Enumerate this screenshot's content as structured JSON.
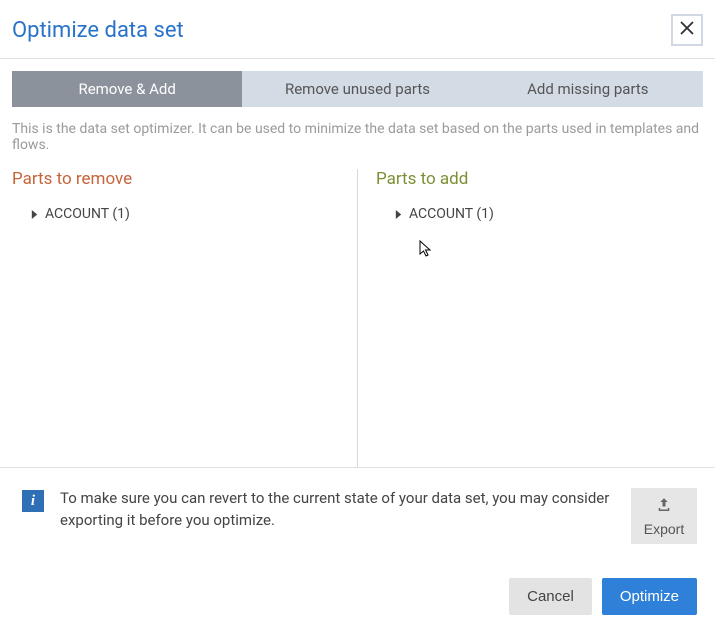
{
  "header": {
    "title": "Optimize data set"
  },
  "tabs": {
    "combined": "Remove & Add",
    "remove": "Remove unused parts",
    "add": "Add missing parts"
  },
  "description": "This is the data set optimizer. It can be used to minimize the data set based on the parts used in templates and flows.",
  "columns": {
    "remove": {
      "title": "Parts to remove",
      "item": "ACCOUNT (1)"
    },
    "add": {
      "title": "Parts to add",
      "item": "ACCOUNT (1)"
    }
  },
  "info": {
    "text": "To make sure you can revert to the current state of your data set, you may consider exporting it before you optimize.",
    "export": "Export"
  },
  "footer": {
    "cancel": "Cancel",
    "optimize": "Optimize"
  }
}
